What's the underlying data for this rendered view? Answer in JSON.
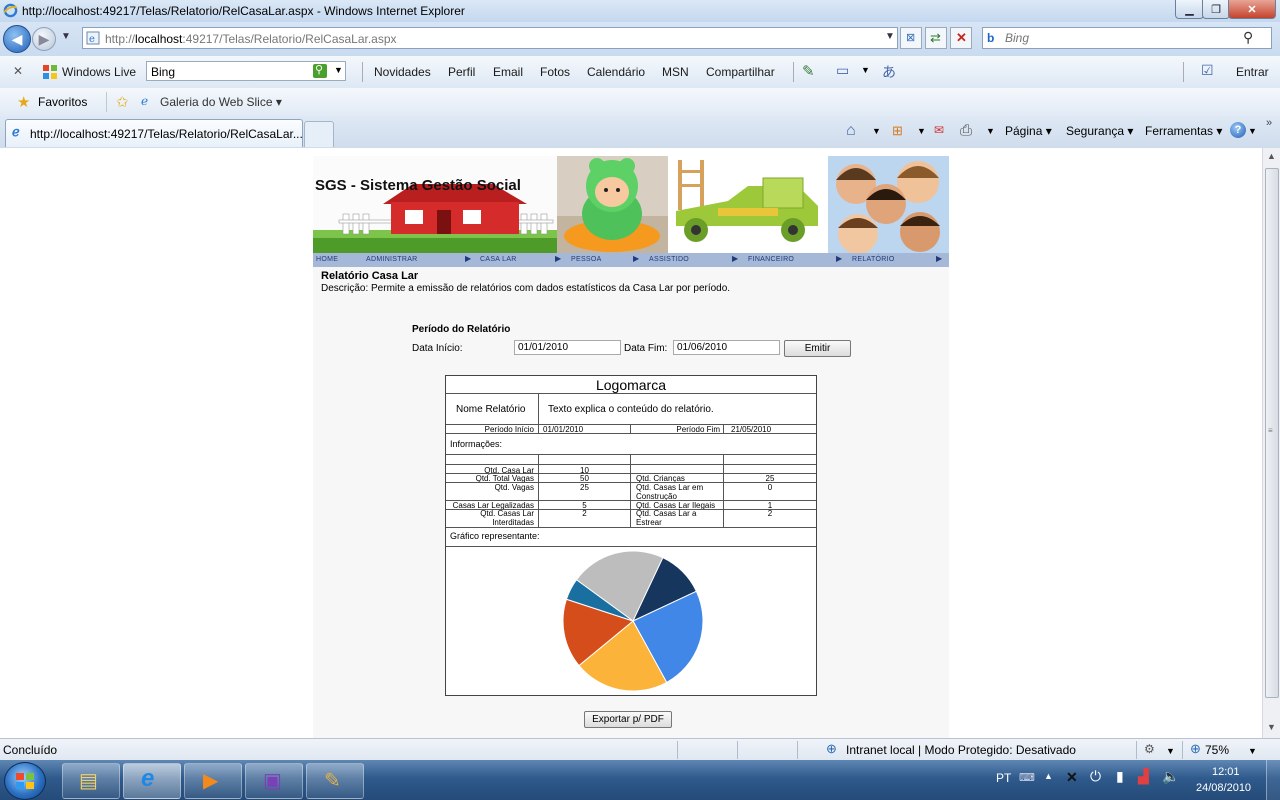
{
  "window": {
    "title": "http://localhost:49217/Telas/Relatorio/RelCasaLar.aspx - Windows Internet Explorer",
    "min_symbol": "▁",
    "max_symbol": "❐",
    "close_symbol": "✕"
  },
  "address": {
    "url_prefix": "http://",
    "url_host": "localhost",
    "url_rest": ":49217/Telas/Relatorio/RelCasaLar.aspx"
  },
  "search": {
    "placeholder": "Bing"
  },
  "toolbar": {
    "close_symbol": "✕",
    "windows_live": "Windows Live",
    "bing_value": "Bing",
    "links": [
      "Novidades",
      "Perfil",
      "Email",
      "Fotos",
      "Calendário",
      "MSN",
      "Compartilhar"
    ],
    "signin": "Entrar"
  },
  "favorites": {
    "label": "Favoritos",
    "gallery": "Galeria do Web Slice ▾"
  },
  "tab": {
    "title": "http://localhost:49217/Telas/Relatorio/RelCasaLar..."
  },
  "commandbar": {
    "page": "Página ▾",
    "security": "Segurança ▾",
    "tools": "Ferramentas ▾"
  },
  "site": {
    "brand": "SGS - Sistema Gestão Social",
    "menu": [
      "HOME",
      "ADMINISTRAR",
      "CASA LAR",
      "PESSOA",
      "ASSISTIDO",
      "FINANCEIRO",
      "RELATÓRIO"
    ],
    "page_title": "Relatório Casa Lar",
    "description": "Descrição: Permite a emissão de relatórios com dados estatísticos da Casa Lar por período.",
    "form": {
      "section": "Período do Relatório",
      "start_label": "Data Início:",
      "start_value": "01/01/2010",
      "end_label": "Data Fim:",
      "end_value": "01/06/2010",
      "emit_button": "Emitir"
    },
    "report": {
      "logo": "Logomarca",
      "name_label": "Nome Relatório",
      "name_text": "Texto explica o conteúdo do relatório.",
      "period_start_label": "Período Início",
      "period_start_value": "01/01/2010",
      "period_end_label": "Período Fim",
      "period_end_value": "21/05/2010",
      "info_label": "Informações:",
      "rows": [
        {
          "l1": "Qtd. Casa Lar",
          "v1": "10",
          "l2": "",
          "v2": ""
        },
        {
          "l1": "Qtd. Total Vagas",
          "v1": "50",
          "l2": "Qtd. Crianças",
          "v2": "25"
        },
        {
          "l1": "Qtd. Vagas",
          "v1": "25",
          "l2": "Qtd. Casas Lar em Construção",
          "v2": "0"
        },
        {
          "l1": "Casas Lar Legalizadas",
          "v1": "5",
          "l2": "Qtd. Casas Lar Ilegais",
          "v2": "1"
        },
        {
          "l1": "Qtd. Casas Lar Interditadas",
          "v1": "2",
          "l2": "Qtd. Casas Lar a Estrear",
          "v2": "2"
        }
      ],
      "chart_label": "Gráfico representante:"
    },
    "export_button": "Exportar p/ PDF"
  },
  "chart_data": {
    "type": "pie",
    "values": [
      22,
      11,
      24,
      22,
      16,
      5
    ],
    "colors": [
      "#bdbdbd",
      "#17365d",
      "#4187e8",
      "#fbb33a",
      "#d64d1c",
      "#1a6fa1"
    ]
  },
  "status": {
    "text": "Concluído",
    "zone": "Intranet local | Modo Protegido: Desativado",
    "zoom": "75%"
  },
  "taskbar": {
    "lang": "PT",
    "time": "12:01",
    "date": "24/08/2010"
  }
}
